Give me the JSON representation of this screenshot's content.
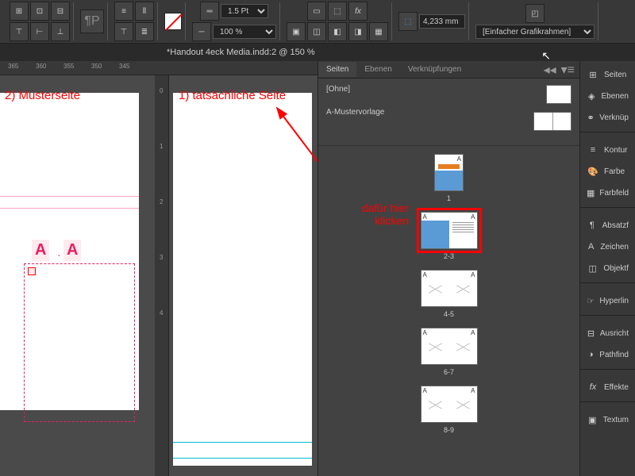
{
  "toolbar": {
    "stroke_weight": "1.5 Pt",
    "scale_percent": "100 %",
    "measurement": "4,233 mm",
    "frame_type": "[Einfacher Grafikrahmen]"
  },
  "document": {
    "tab_title": "*Handout 4eck Media.indd:2 @ 150 %"
  },
  "ruler_h": [
    "365",
    "360",
    "355",
    "350",
    "345"
  ],
  "ruler_v": [
    "0",
    "1",
    "2",
    "3",
    "4"
  ],
  "annotations": {
    "master_label": "2) Musterseite",
    "actual_label": "1) tatsächliche Seite",
    "click_here_line1": "dafür hier",
    "click_here_line2": "klicken",
    "a_letter": "A"
  },
  "panels": {
    "tabs": [
      "Seiten",
      "Ebenen",
      "Verknüpfungen"
    ],
    "master_none": "[Ohne]",
    "master_template": "A-Mustervorlage"
  },
  "spreads": [
    {
      "label": "1"
    },
    {
      "label": "2-3"
    },
    {
      "label": "4-5"
    },
    {
      "label": "6-7"
    },
    {
      "label": "8-9"
    }
  ],
  "sidebar": {
    "items": [
      "Seiten",
      "Ebenen",
      "Verknüp",
      "Kontur",
      "Farbe",
      "Farbfeld",
      "Absatzf",
      "Zeichen",
      "Objektf",
      "Hyperlin",
      "Ausricht",
      "Pathfind",
      "Effekte",
      "Textum"
    ]
  }
}
